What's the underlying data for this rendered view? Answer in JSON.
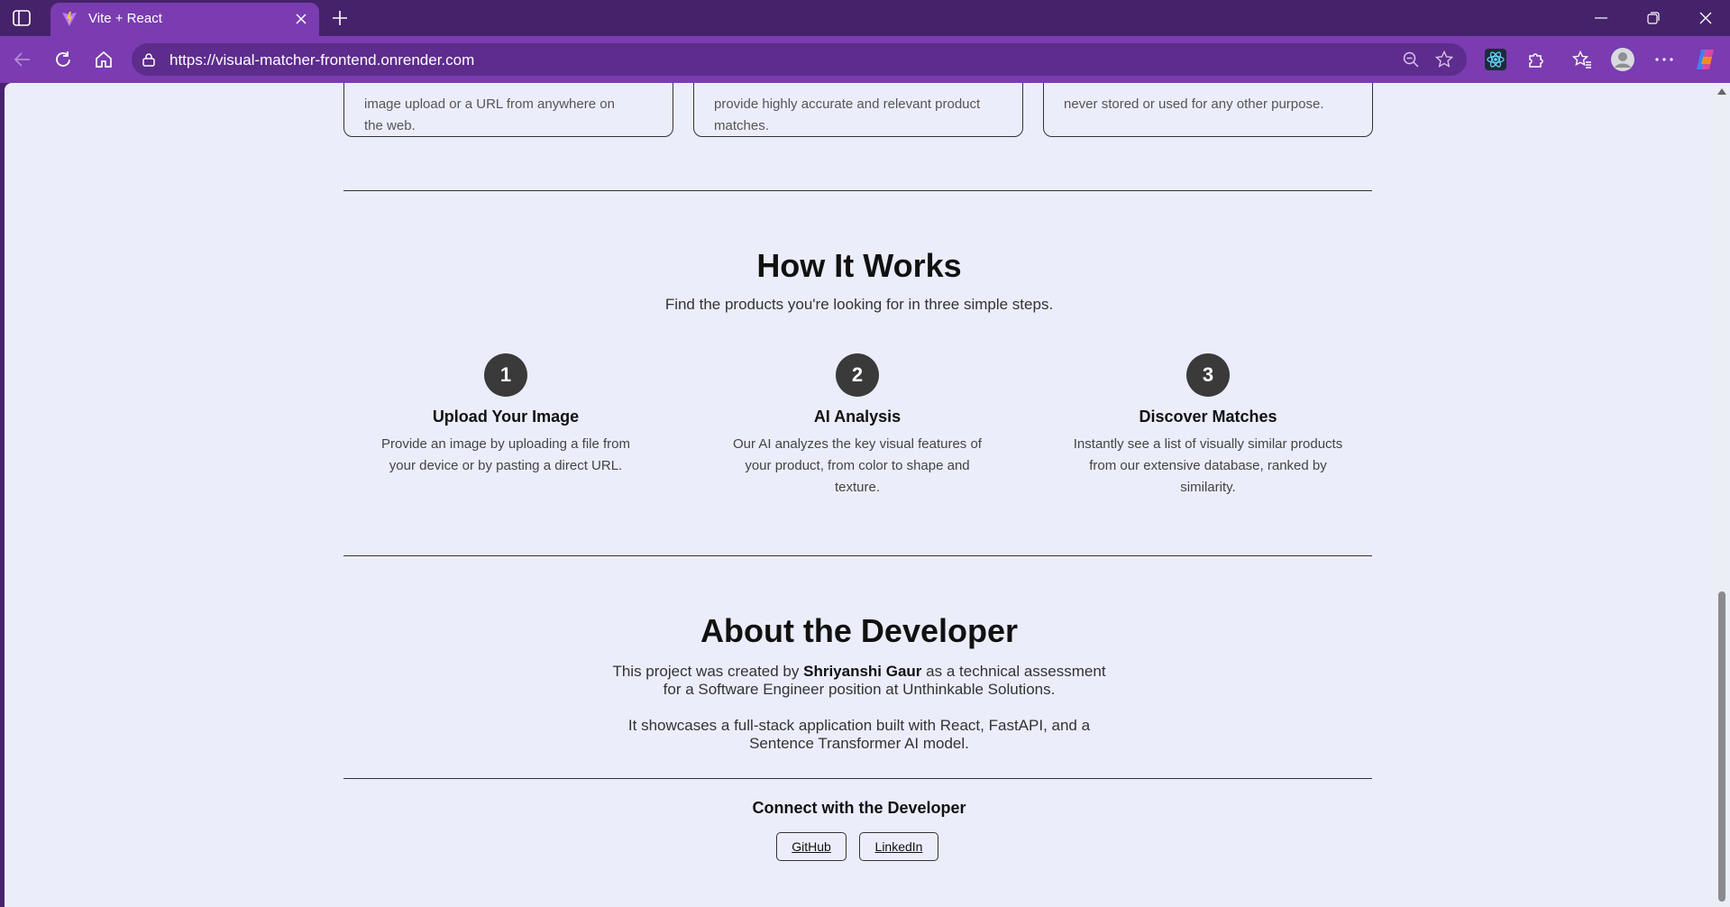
{
  "browser": {
    "tab_title": "Vite + React",
    "url": "https://visual-matcher-frontend.onrender.com"
  },
  "features": [
    {
      "text_line1": "image upload or a URL from anywhere on",
      "text_line2": "the web."
    },
    {
      "text_line1": "provide highly accurate and relevant product",
      "text_line2": "matches."
    },
    {
      "text_line1": "never stored or used for any other purpose.",
      "text_line2": ""
    }
  ],
  "how": {
    "title": "How It Works",
    "subtitle": "Find the products you're looking for in three simple steps.",
    "steps": [
      {
        "num": "1",
        "title": "Upload Your Image",
        "desc": "Provide an image by uploading a file from your device or by pasting a direct URL."
      },
      {
        "num": "2",
        "title": "AI Analysis",
        "desc": "Our AI analyzes the key visual features of your product, from color to shape and texture."
      },
      {
        "num": "3",
        "title": "Discover Matches",
        "desc": "Instantly see a list of visually similar products from our extensive database, ranked by similarity."
      }
    ]
  },
  "about": {
    "title": "About the Developer",
    "p1_before": "This project was created by ",
    "p1_name": "Shriyanshi Gaur",
    "p1_after": " as a technical assessment for a Software Engineer position at Unthinkable Solutions.",
    "p2": "It showcases a full-stack application built with React, FastAPI, and a Sentence Transformer AI model."
  },
  "connect": {
    "title": "Connect with the Developer",
    "github": "GitHub",
    "linkedin": "LinkedIn"
  },
  "icons": {
    "tab_actions": "tab-actions-icon",
    "close": "close-icon",
    "new_tab": "plus-icon",
    "back": "back-arrow-icon",
    "refresh": "refresh-icon",
    "home": "home-icon",
    "lock": "lock-icon",
    "zoom": "zoom-out-icon",
    "star": "star-icon",
    "react_devtools": "react-icon",
    "extensions": "puzzle-icon",
    "favorites": "favorites-icon",
    "profile": "profile-icon",
    "more": "more-icon",
    "copilot": "copilot-icon"
  },
  "colors": {
    "frame": "#45226a",
    "toolbar": "#7a3cb0",
    "page_bg": "#ecedfb",
    "step_badge": "#3a3a3a"
  }
}
